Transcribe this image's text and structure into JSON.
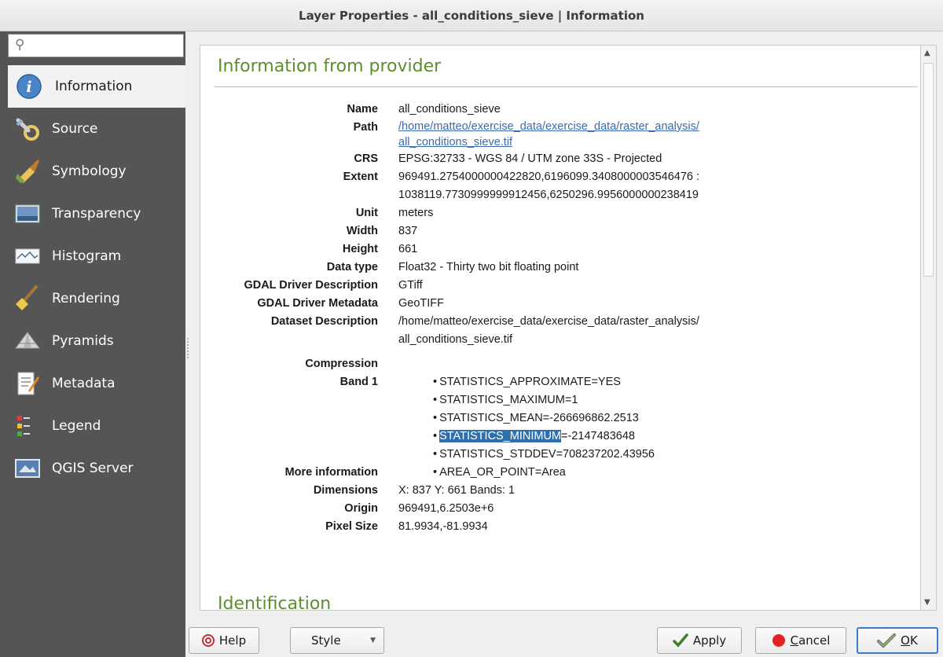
{
  "window": {
    "title": "Layer Properties - all_conditions_sieve | Information"
  },
  "search": {
    "placeholder": "",
    "value": ""
  },
  "sidebar": {
    "items": [
      {
        "label": "Information",
        "icon": "info-icon",
        "active": true
      },
      {
        "label": "Source",
        "icon": "wrench-icon"
      },
      {
        "label": "Symbology",
        "icon": "paintbrush-icon"
      },
      {
        "label": "Transparency",
        "icon": "transparency-icon"
      },
      {
        "label": "Histogram",
        "icon": "histogram-icon"
      },
      {
        "label": "Rendering",
        "icon": "broom-icon"
      },
      {
        "label": "Pyramids",
        "icon": "pyramid-icon"
      },
      {
        "label": "Metadata",
        "icon": "metadata-icon"
      },
      {
        "label": "Legend",
        "icon": "legend-icon"
      },
      {
        "label": "QGIS Server",
        "icon": "server-icon"
      }
    ]
  },
  "content": {
    "provider_title": "Information from provider",
    "identification_title": "Identification",
    "rows": {
      "name": {
        "key": "Name",
        "value": "all_conditions_sieve"
      },
      "path": {
        "key": "Path",
        "line1": "/home/matteo/exercise_data/exercise_data/raster_analysis/",
        "line2": "all_conditions_sieve.tif"
      },
      "crs": {
        "key": "CRS",
        "value": "EPSG:32733 - WGS 84 / UTM zone 33S - Projected"
      },
      "extent": {
        "key": "Extent",
        "line1": "969491.2754000000422820,6196099.3408000003546476 :",
        "line2": "1038119.7730999999912456,6250296.9956000000238419"
      },
      "unit": {
        "key": "Unit",
        "value": "meters"
      },
      "width": {
        "key": "Width",
        "value": "837"
      },
      "height": {
        "key": "Height",
        "value": "661"
      },
      "data_type": {
        "key": "Data type",
        "value": "Float32 - Thirty two bit floating point"
      },
      "gdal_desc": {
        "key": "GDAL Driver Description",
        "value": "GTiff"
      },
      "gdal_meta": {
        "key": "GDAL Driver Metadata",
        "value": "GeoTIFF"
      },
      "dataset_desc": {
        "key": "Dataset Description",
        "line1": "/home/matteo/exercise_data/exercise_data/raster_analysis/",
        "line2": "all_conditions_sieve.tif"
      },
      "compression": {
        "key": "Compression",
        "value": ""
      },
      "band1": {
        "key": "Band 1",
        "items": [
          "STATISTICS_APPROXIMATE=YES",
          "STATISTICS_MAXIMUM=1",
          "STATISTICS_MEAN=-266696862.2513"
        ],
        "min_selected": "STATISTICS_MINIMUM",
        "min_rest": "=-2147483648",
        "stddev": "STATISTICS_STDDEV=708237202.43956"
      },
      "more_info": {
        "key": "More information",
        "value": "AREA_OR_POINT=Area"
      },
      "dimensions": {
        "key": "Dimensions",
        "value": "X: 837 Y: 661 Bands: 1"
      },
      "origin": {
        "key": "Origin",
        "value": "969491,6.2503e+6"
      },
      "pixel_size": {
        "key": "Pixel Size",
        "value": "81.9934,-81.9934"
      }
    }
  },
  "buttons": {
    "help": "Help",
    "style": "Style",
    "apply": "Apply",
    "cancel_underlined": "C",
    "cancel_rest": "ancel",
    "ok_underlined": "O",
    "ok_rest": "K"
  },
  "colors": {
    "sidebar_bg": "#555555",
    "section_title": "#5b8f2e",
    "link": "#3b6bb0",
    "selection": "#2f6fad"
  }
}
